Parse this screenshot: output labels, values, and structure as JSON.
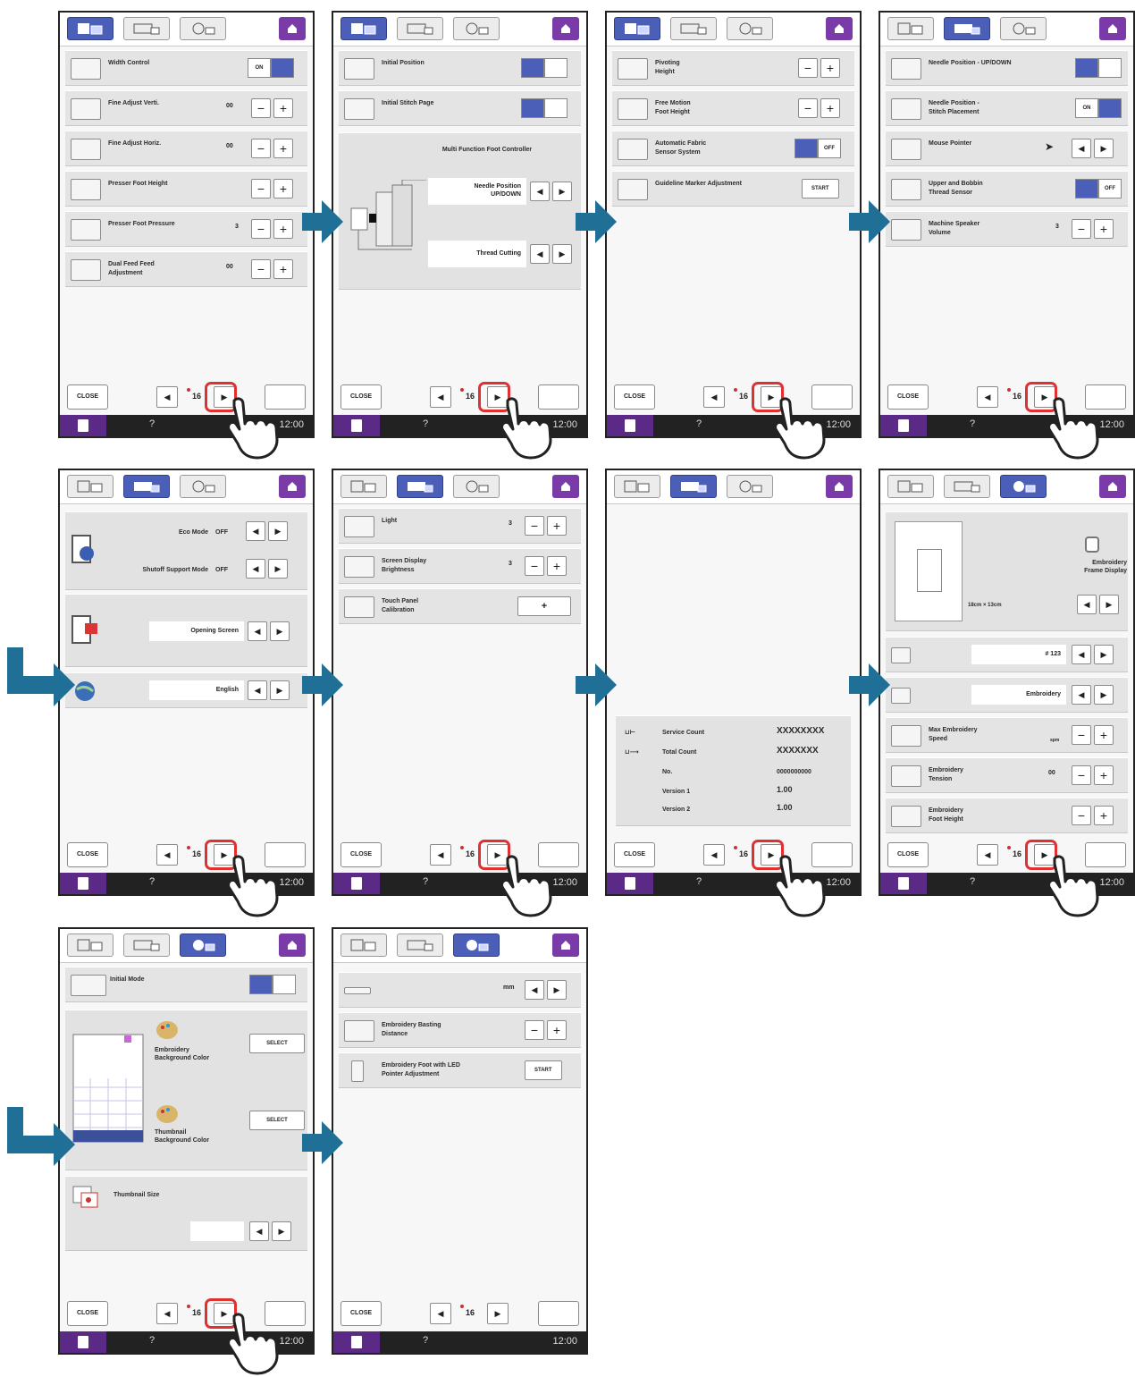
{
  "common": {
    "close_label": "CLOSE",
    "page_label": "16",
    "prev_glyph": "◀",
    "next_glyph": "▶",
    "help_glyph": "?",
    "clock": "12:00",
    "colors": {
      "tab_active": "#4b5fb8",
      "home": "#7a3aa8",
      "highlight": "#e03131",
      "arrow": "#1f6f96",
      "status": "#222222"
    }
  },
  "screen1": {
    "rows": [
      {
        "label": "Width Control",
        "state_on": "ON"
      },
      {
        "label": "Fine Adjust Verti.",
        "value": "00"
      },
      {
        "label": "Fine Adjust Horiz.",
        "value": "00"
      },
      {
        "label": "Presser Foot Height",
        "value": ""
      },
      {
        "label": "Presser Foot Pressure",
        "value": "3"
      },
      {
        "label": "Dual Feed Feed\nAdjustment",
        "value": "00"
      }
    ]
  },
  "screen2": {
    "rows": [
      {
        "label": "Initial Position"
      },
      {
        "label": "Initial Stitch Page"
      }
    ],
    "panel_title": "Multi Function Foot Controller",
    "option1": "Needle Position\nUP/DOWN",
    "option2": "Thread Cutting"
  },
  "screen3": {
    "rows": [
      {
        "label": "Pivoting\nHeight"
      },
      {
        "label": "Free Motion\nFoot Height"
      },
      {
        "label": "Automatic Fabric\nSensor System",
        "state_off": "OFF"
      },
      {
        "label": "Guideline Marker Adjustment",
        "button": "START"
      }
    ]
  },
  "screen4": {
    "rows": [
      {
        "label": "Needle Position - UP/DOWN"
      },
      {
        "label": "Needle Position -\nStitch Placement",
        "state_on": "ON"
      },
      {
        "label": "Mouse Pointer"
      },
      {
        "label": "Upper and Bobbin\nThread Sensor",
        "state_off": "OFF"
      },
      {
        "label": "Machine Speaker\nVolume",
        "value": "3"
      }
    ]
  },
  "screen5": {
    "eco_label": "Eco Mode",
    "eco_value": "OFF",
    "shutoff_label": "Shutoff Support Mode",
    "shutoff_value": "OFF",
    "opening_value": "Opening Screen",
    "language_value": "English"
  },
  "screen6": {
    "rows": [
      {
        "label": "Light",
        "value": "3"
      },
      {
        "label": "Screen Display\nBrightness",
        "value": "3"
      },
      {
        "label": "Touch Panel\nCalibration",
        "button": "+"
      }
    ]
  },
  "screen7": {
    "service_label": "Service Count",
    "service_value": "XXXXXXXX",
    "total_label": "Total Count",
    "total_value": "XXXXXXX",
    "no_label": "No.",
    "no_value": "0000000000",
    "v1_label": "Version 1",
    "v1_value": "1.00",
    "v2_label": "Version 2",
    "v2_value": "1.00"
  },
  "screen8": {
    "frame_label": "Embroidery\nFrame Display",
    "frame_size": "18cm × 13cm",
    "field1_value": "# 123",
    "field2_value": "Embroidery",
    "rows": [
      {
        "label": "Max Embroidery\nSpeed",
        "unit": "spm"
      },
      {
        "label": "Embroidery\nTension",
        "value": "00"
      },
      {
        "label": "Embroidery\nFoot Height"
      }
    ]
  },
  "screen9": {
    "initial_mode_label": "Initial Mode",
    "bg_color_label": "Embroidery\nBackground Color",
    "thumb_color_label": "Thumbnail\nBackground Color",
    "select_label": "SELECT",
    "thumb_size_label": "Thumbnail Size"
  },
  "screen10": {
    "unit_value": "mm",
    "rows": [
      {
        "label": "Embroidery Basting\nDistance"
      },
      {
        "label": "Embroidery Foot with LED\nPointer Adjustment",
        "button": "START"
      }
    ]
  }
}
